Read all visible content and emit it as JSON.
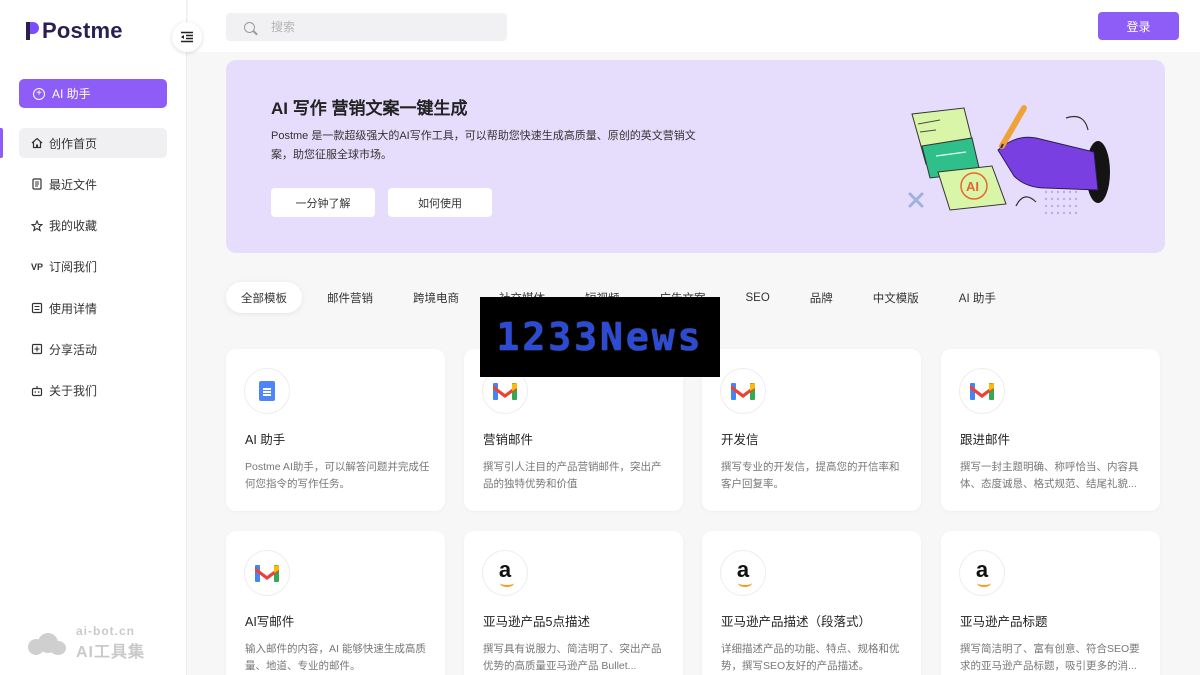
{
  "sidebar": {
    "logo_text": "Postme",
    "ai_button_label": "AI 助手",
    "items": [
      {
        "label": "创作首页",
        "icon": "home-icon"
      },
      {
        "label": "最近文件",
        "icon": "file-icon"
      },
      {
        "label": "我的收藏",
        "icon": "star-icon"
      },
      {
        "label": "订阅我们",
        "icon": "vip-icon"
      },
      {
        "label": "使用详情",
        "icon": "details-icon"
      },
      {
        "label": "分享活动",
        "icon": "share-icon"
      },
      {
        "label": "关于我们",
        "icon": "robot-icon"
      }
    ],
    "watermark": {
      "line1": "ai-bot.cn",
      "line2": "AI工具集"
    }
  },
  "topbar": {
    "search_placeholder": "搜索",
    "login_label": "登录"
  },
  "hero": {
    "title": "AI 写作 营销文案一键生成",
    "description": "Postme 是一款超级强大的AI写作工具，可以帮助您快速生成高质量、原创的英文营销文案，助您征服全球市场。",
    "button1": "一分钟了解",
    "button2": "如何使用"
  },
  "tabs": [
    "全部模板",
    "邮件营销",
    "跨境电商",
    "社交媒体",
    "短视频",
    "广告文案",
    "SEO",
    "品牌",
    "中文模版",
    "AI 助手"
  ],
  "overlay_banner": "1233News",
  "cards": [
    {
      "title": "AI 助手",
      "desc": "Postme AI助手，可以解答问题并完成任何您指令的写作任务。",
      "icon": "doc-icon"
    },
    {
      "title": "营销邮件",
      "desc": "撰写引人注目的产品营销邮件，突出产品的独特优势和价值",
      "icon": "gmail-icon"
    },
    {
      "title": "开发信",
      "desc": "撰写专业的开发信，提高您的开信率和客户回复率。",
      "icon": "gmail-icon"
    },
    {
      "title": "跟进邮件",
      "desc": "撰写一封主题明确、称呼恰当、内容具体、态度诚恳、格式规范、结尾礼貌...",
      "icon": "gmail-icon"
    },
    {
      "title": "AI写邮件",
      "desc": "输入邮件的内容，AI 能够快速生成高质量、地道、专业的邮件。",
      "icon": "gmail-icon"
    },
    {
      "title": "亚马逊产品5点描述",
      "desc": "撰写具有说服力、简洁明了、突出产品优势的高质量亚马逊产品 Bullet...",
      "icon": "amazon-icon"
    },
    {
      "title": "亚马逊产品描述（段落式）",
      "desc": "详细描述产品的功能、特点、规格和优势，撰写SEO友好的产品描述。",
      "icon": "amazon-icon"
    },
    {
      "title": "亚马逊产品标题",
      "desc": "撰写简洁明了、富有创意、符合SEO要求的亚马逊产品标题，吸引更多的消...",
      "icon": "amazon-icon"
    }
  ],
  "colors": {
    "accent": "#8e5cf7",
    "hero_bg": "#e6ddfc",
    "page_bg": "#f7f7f8"
  }
}
